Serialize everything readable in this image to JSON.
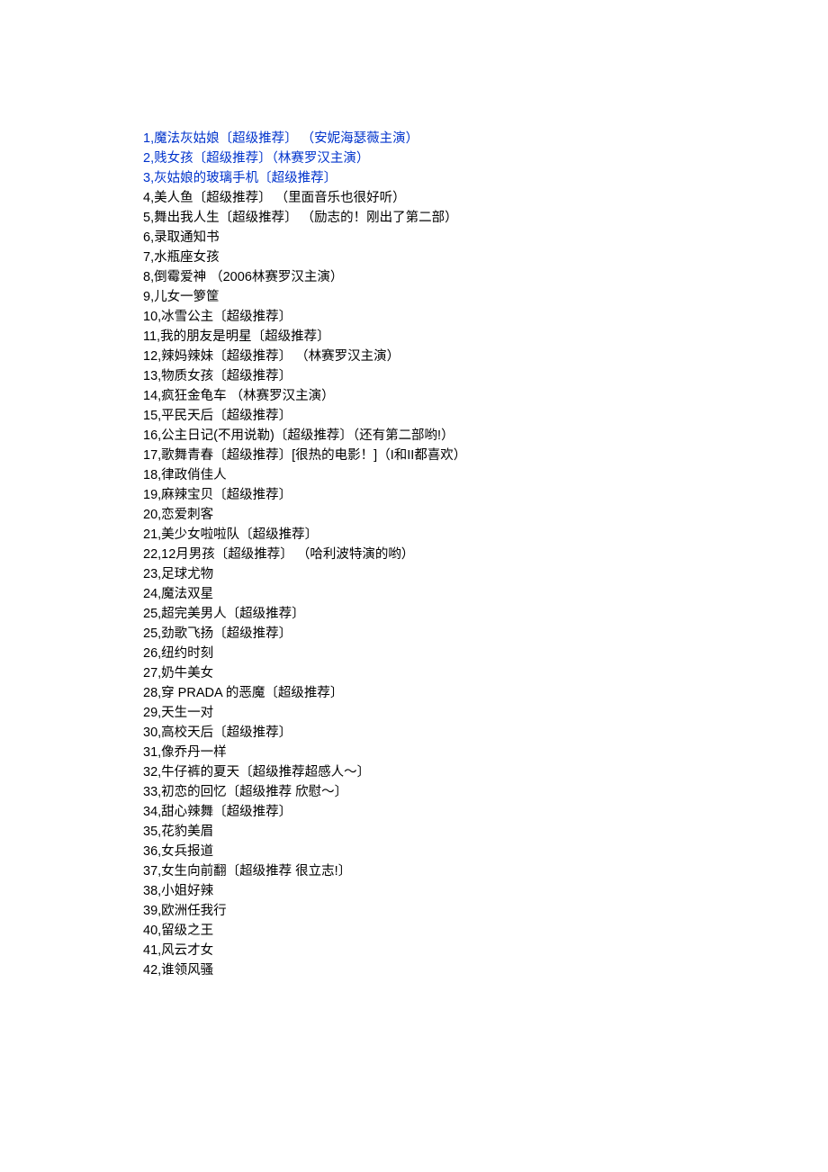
{
  "items": [
    {
      "text": "1,魔法灰姑娘〔超级推荐〕 （安妮海瑟薇主演）",
      "link": true
    },
    {
      "text": "2,贱女孩〔超级推荐〕（林赛罗汉主演）",
      "link": true
    },
    {
      "text": "3,灰姑娘的玻璃手机〔超级推荐〕",
      "link": true
    },
    {
      "text": "4,美人鱼〔超级推荐〕 （里面音乐也很好听）",
      "link": false
    },
    {
      "text": "5,舞出我人生〔超级推荐〕 （励志的！刚出了第二部）",
      "link": false
    },
    {
      "text": "6,录取通知书",
      "link": false
    },
    {
      "text": "7,水瓶座女孩",
      "link": false
    },
    {
      "text": "8,倒霉爱神 （2006林赛罗汉主演）",
      "link": false
    },
    {
      "text": "9,儿女一箩筐",
      "link": false
    },
    {
      "text": "10,冰雪公主〔超级推荐〕",
      "link": false
    },
    {
      "text": "11,我的朋友是明星〔超级推荐〕",
      "link": false
    },
    {
      "text": "12,辣妈辣妹〔超级推荐〕 （林赛罗汉主演）",
      "link": false
    },
    {
      "text": "13,物质女孩〔超级推荐〕",
      "link": false
    },
    {
      "text": "14,疯狂金龟车 （林赛罗汉主演）",
      "link": false
    },
    {
      "text": "15,平民天后〔超级推荐〕",
      "link": false
    },
    {
      "text": "16,公主日记(不用说勒)〔超级推荐〕（还有第二部哟!）",
      "link": false
    },
    {
      "text": "17,歌舞青春〔超级推荐〕[很热的电影！]（I和II都喜欢）",
      "link": false
    },
    {
      "text": "18,律政俏佳人",
      "link": false
    },
    {
      "text": "19,麻辣宝贝〔超级推荐〕",
      "link": false
    },
    {
      "text": "20,恋爱刺客",
      "link": false
    },
    {
      "text": "21,美少女啦啦队〔超级推荐〕",
      "link": false
    },
    {
      "text": "22,12月男孩〔超级推荐〕 （哈利波特演的哟）",
      "link": false
    },
    {
      "text": "23,足球尤物",
      "link": false
    },
    {
      "text": "24,魔法双星",
      "link": false
    },
    {
      "text": "25,超完美男人〔超级推荐〕",
      "link": false
    },
    {
      "text": "25,劲歌飞扬〔超级推荐〕",
      "link": false
    },
    {
      "text": "26,纽约时刻",
      "link": false
    },
    {
      "text": "27,奶牛美女",
      "link": false
    },
    {
      "text": "28,穿 PRADA 的恶魔〔超级推荐〕",
      "link": false
    },
    {
      "text": "29,天生一对",
      "link": false
    },
    {
      "text": "30,高校天后〔超级推荐〕",
      "link": false
    },
    {
      "text": "31,像乔丹一样",
      "link": false
    },
    {
      "text": "32,牛仔裤的夏天〔超级推荐超感人～〕",
      "link": false
    },
    {
      "text": "33,初恋的回忆〔超级推荐 欣慰～〕",
      "link": false
    },
    {
      "text": "34,甜心辣舞〔超级推荐〕",
      "link": false
    },
    {
      "text": "35,花豹美眉",
      "link": false
    },
    {
      "text": "36,女兵报道",
      "link": false
    },
    {
      "text": "37,女生向前翻〔超级推荐 很立志!〕",
      "link": false
    },
    {
      "text": "38,小姐好辣",
      "link": false
    },
    {
      "text": "39,欧洲任我行",
      "link": false
    },
    {
      "text": "40,留级之王",
      "link": false
    },
    {
      "text": "41,风云才女",
      "link": false
    },
    {
      "text": "42,谁领风骚",
      "link": false
    }
  ]
}
